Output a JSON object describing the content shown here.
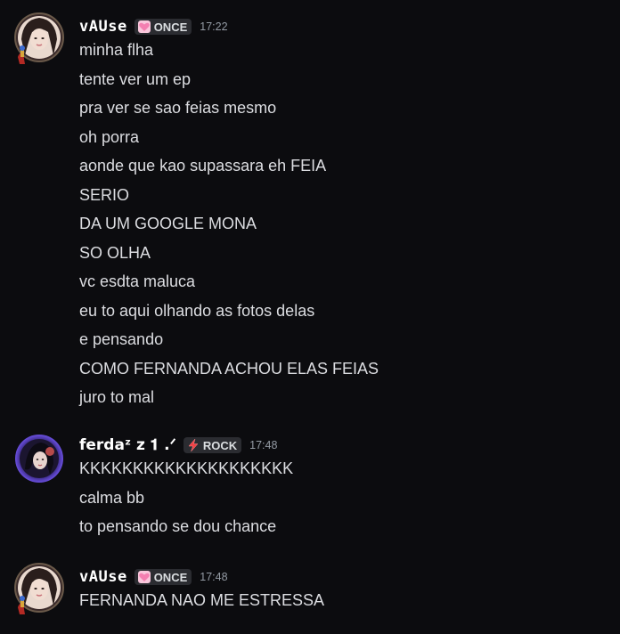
{
  "messages": [
    {
      "author": "vAUse",
      "tag": {
        "label": "ONCE",
        "icon": "pink-heart-icon"
      },
      "time": "17:22",
      "lines": [
        "minha flha",
        "tente ver um ep",
        "pra ver se sao feias mesmo",
        "oh porra",
        "aonde que kao supassara eh FEIA",
        "SERIO",
        "DA UM GOOGLE MONA",
        "SO OLHA",
        "vc esdta maluca",
        "eu to aqui olhando as fotos delas",
        "e pensando",
        "COMO FERNANDA ACHOU ELAS FEIAS",
        "juro to mal"
      ]
    },
    {
      "author": "ferdaᶻ z 𝟏 .ᐟ",
      "tag": {
        "label": "ROCK",
        "icon": "lightning-bolt-icon"
      },
      "time": "17:48",
      "lines": [
        "KKKKKKKKKKKKKKKKKKKK",
        "calma bb",
        "to pensando se dou chance"
      ]
    },
    {
      "author": "vAUse",
      "tag": {
        "label": "ONCE",
        "icon": "pink-heart-icon"
      },
      "time": "17:48",
      "lines": [
        "FERNANDA NAO ME ESTRESSA"
      ]
    }
  ],
  "colors": {
    "background": "#0c0c0f",
    "username": "#ffffff",
    "message_text": "#dcdde1",
    "timestamp": "#949ba4",
    "tag_background": "#2b2c31",
    "heart": "#f47fb1",
    "bolt": "#f23f43"
  }
}
